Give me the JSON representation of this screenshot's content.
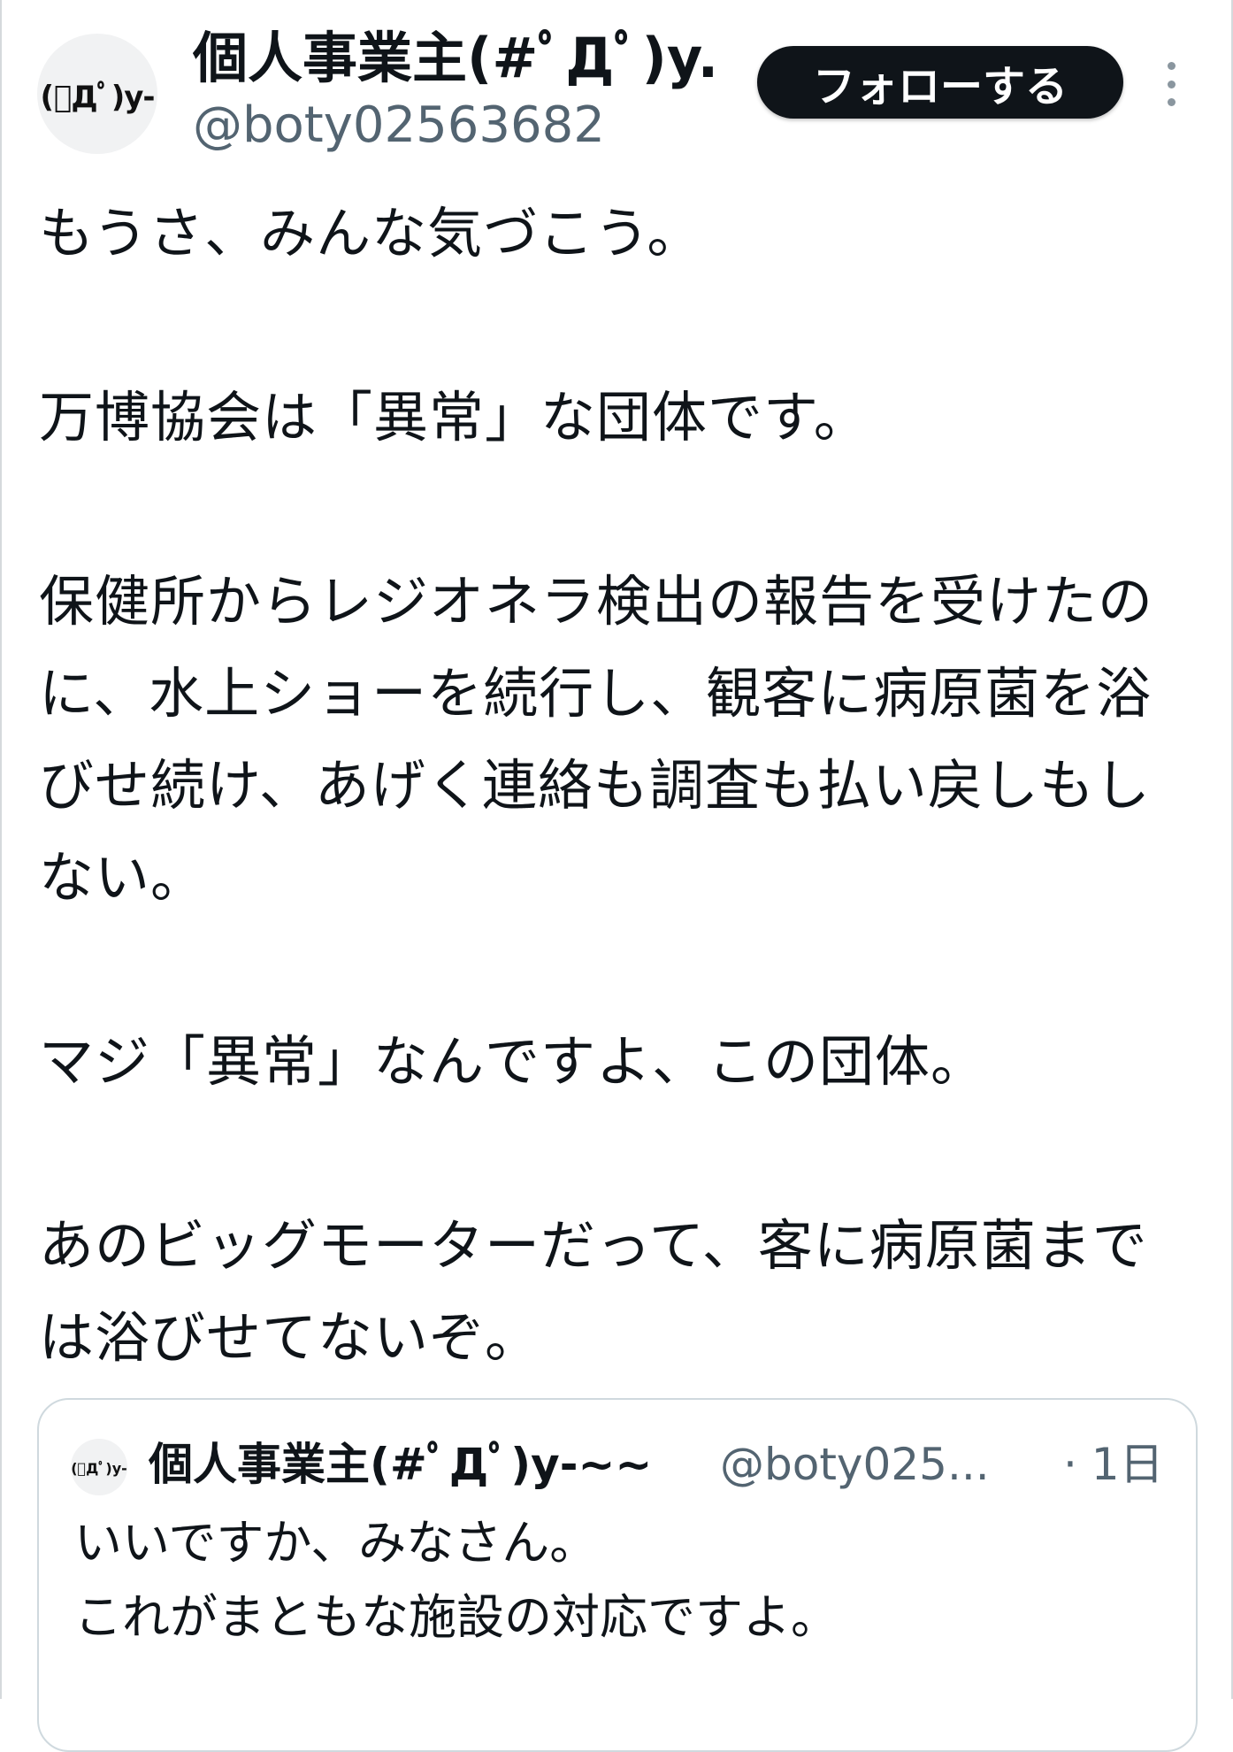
{
  "author": {
    "avatar_text": "(ﾟДﾟ)y-",
    "display_name": "個人事業主(#ﾟДﾟ)y...",
    "handle": "@boty02563682"
  },
  "actions": {
    "follow_label": "フォローする",
    "more_icon": "more-vertical-icon"
  },
  "tweet": {
    "paragraphs": [
      "もうさ、みんな気づこう。",
      "万博協会は「異常」な団体です。",
      "保健所からレジオネラ検出の報告を受けたのに、水上ショーを続行し、観客に病原菌を浴びせ続け、あげく連絡も調査も払い戻しもしない。",
      "マジ「異常」なんですよ、この団体。",
      "あのビッグモーターだって、客に病原菌までは浴びせてないぞ。"
    ]
  },
  "quoted_tweet": {
    "avatar_text": "(ﾟДﾟ)y-",
    "display_name": "個人事業主(#ﾟДﾟ)y-~~",
    "handle": "@boty025...",
    "time": "· 1日",
    "lines": [
      "いいですか、みなさん。",
      "これがまともな施設の対応ですよ。"
    ]
  }
}
